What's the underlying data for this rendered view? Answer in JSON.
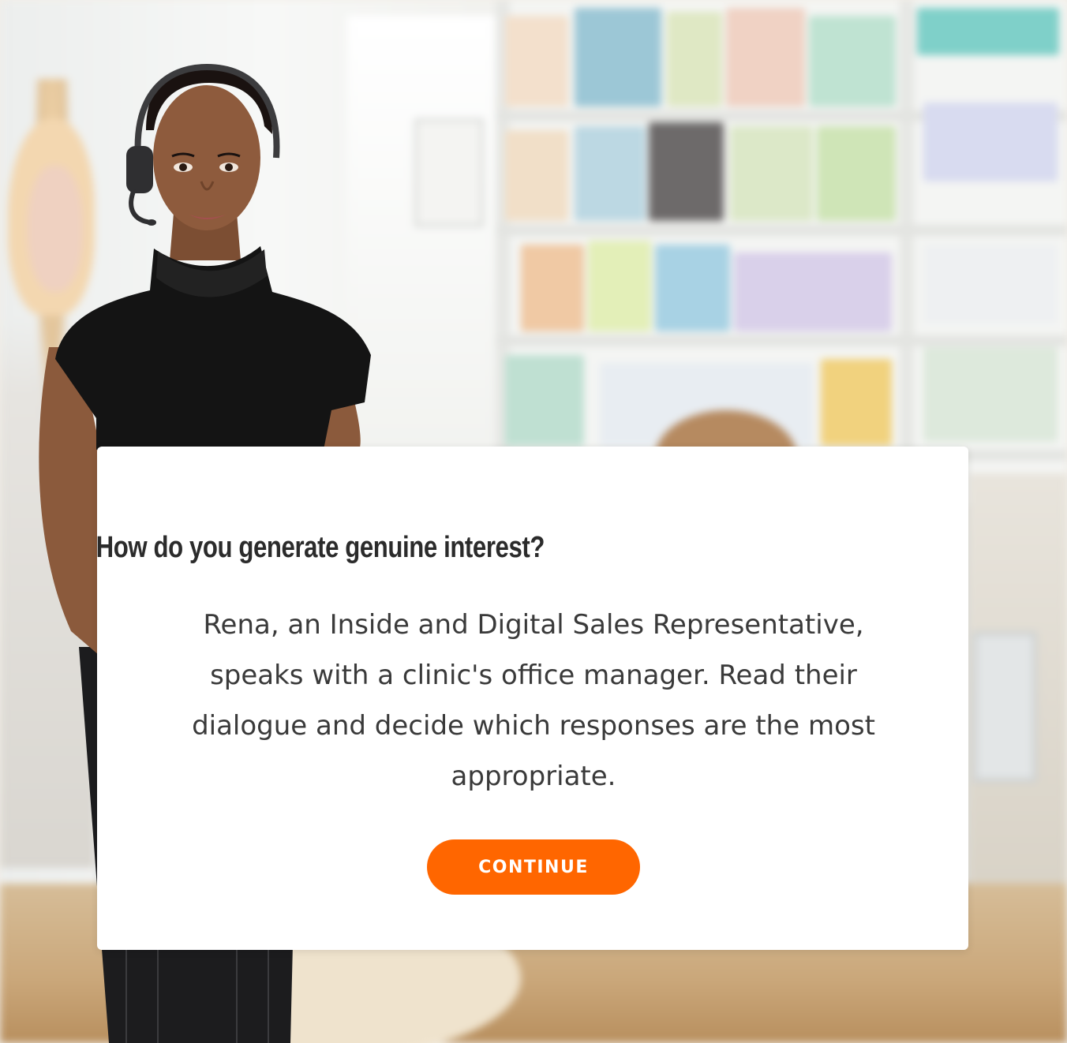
{
  "dialog": {
    "title": "How do you generate genuine interest?",
    "body": "Rena, an Inside and Digital Sales Representative, speaks with a clinic's office manager.  Read their dialogue and decide which responses are the most appropriate.",
    "continue_label": "CONTINUE"
  },
  "colors": {
    "accent": "#ff6600",
    "card_background": "#ffffff",
    "title_text": "#2b2b2b",
    "body_text": "#3a3a3a"
  },
  "icons": {
    "headset": "headset-icon"
  }
}
